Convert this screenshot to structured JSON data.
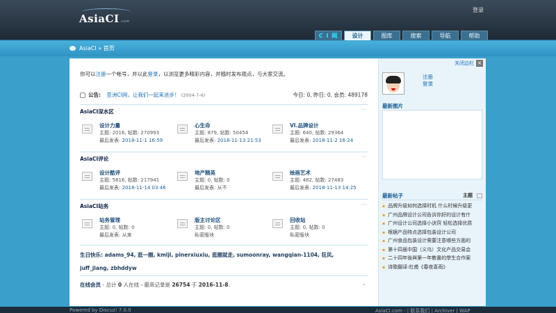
{
  "header": {
    "logo_text": "AsiaCI",
    "logo_sub": ".com",
    "login_link": "登录",
    "nav": [
      {
        "label": "C I 网"
      },
      {
        "label": "设计"
      },
      {
        "label": "图库"
      },
      {
        "label": "搜索"
      },
      {
        "label": "导航"
      },
      {
        "label": "帮助"
      }
    ]
  },
  "breadcrumb": {
    "site": "AsiaCI",
    "sep": " » ",
    "page": "首页"
  },
  "welcome": {
    "pre": "你可以",
    "register": "注册",
    "mid": "一个帐号，并以此",
    "login": "登录",
    "post": "，以浏览更多精彩内容，并随时发布观点，与大家交流。"
  },
  "announcement": {
    "label": "公告:",
    "text": "亚洲CI网，让我们一起来进步！",
    "date": "(2004-7-6)",
    "stats": "今日: 0, 昨日: 0, 会员: 489178"
  },
  "sections": [
    {
      "title": "AsiaCI深水区",
      "forums": [
        {
          "name": "设计力量",
          "stats": "主题: 2016, 帖数: 270993",
          "last_label": "最后发表: ",
          "last": "2018-11-1 16:59"
        },
        {
          "name": "心生命",
          "stats": "主题: 879, 帖数: 50454",
          "last_label": "最后发表: ",
          "last": "2018-11-13 21:53"
        },
        {
          "name": "VI.品牌设计",
          "stats": "主题: 640, 帖数: 29364",
          "last_label": "最后发表: ",
          "last": "2018-11-2 16:24"
        }
      ]
    },
    {
      "title": "AsiaCI评论",
      "forums": [
        {
          "name": "设计酷评",
          "stats": "主题: 5816, 帖数: 217941",
          "last_label": "最后发表: ",
          "last": "2018-11-14 03:46"
        },
        {
          "name": "地产精英",
          "stats": "主题: 0, 帖数: 0",
          "last_label": "最后发表: ",
          "last": "从不"
        },
        {
          "name": "绘画艺术",
          "stats": "主题: 482, 帖数: 27483",
          "last_label": "最后发表: ",
          "last": "2018-11-13 14:25"
        }
      ]
    },
    {
      "title": "AsiaCI站务",
      "forums": [
        {
          "name": "站务管理",
          "stats": "主题: 0, 帖数: 0",
          "last_label": "最后发表: ",
          "last": "从来"
        },
        {
          "name": "版主讨论区",
          "stats": "主题: 0, 帖数: 0",
          "last_label": "",
          "last": "私密版块"
        },
        {
          "name": "回收站",
          "stats": "主题: 0, 帖数: 0",
          "last_label": "",
          "last": "私密版块"
        }
      ]
    }
  ],
  "birthday": {
    "line1": "生日快乐: adams_94, 逛一圈, kmljl, pinerxiuxiu, 逛圈就走, sumoonray, wangqian-1104, 狂风,",
    "line2": "juff_jiang, zbhddyw"
  },
  "online": {
    "title": "在线会员",
    "pre": " - 总计 ",
    "total": "0",
    "mid": " 人在线 - 最高记录是 ",
    "record": "26754",
    "mid2": " 于 ",
    "record_date": "2016-11-8",
    "end": "."
  },
  "sidebar": {
    "close_label": "关闭边栏",
    "close_x": "×",
    "register": "注册",
    "login": "登录",
    "new_images_title": "最新图片",
    "new_posts_title": "最新帖子",
    "topic_label": "主题",
    "posts": [
      "品牌升级如何选择时机 什么时候升级更",
      "广州品牌设计公司告诉你好的设计有什",
      "广州设计公司选择小诀窍 轻松选择优质",
      "根据产品特点选择包装设计公司",
      "广州食品包装设计需要注意哪些方面的",
      "第十四届中国（义乌）文化产品交易会",
      "二十四年後與第一年教書的學生合作案",
      "诗歌翻译:杜甫《春夜喜雨》"
    ]
  },
  "footer": {
    "left": "Powered by Discuz! 7.0.0",
    "right": "AsiaCI.com - | 联系我们 | Archiver | WAP"
  }
}
